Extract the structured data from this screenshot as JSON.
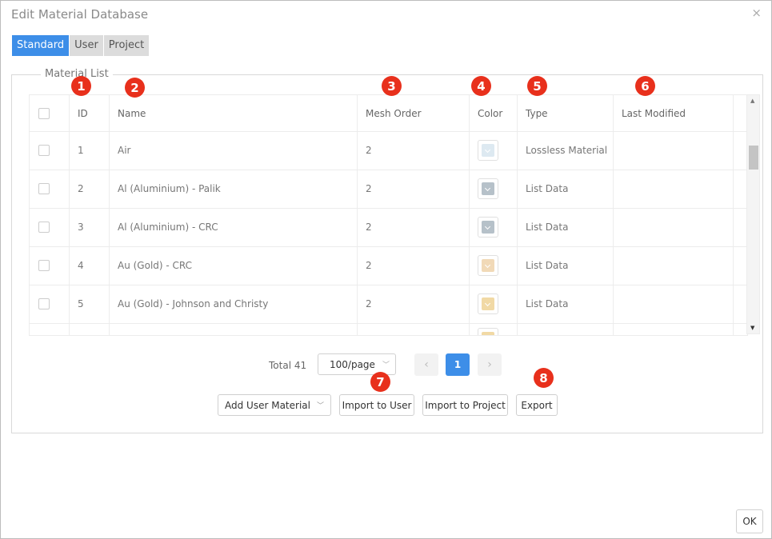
{
  "dialog": {
    "title": "Edit Material Database",
    "close_glyph": "×"
  },
  "tabs": [
    {
      "label": "Standard",
      "active": true
    },
    {
      "label": "User",
      "active": false
    },
    {
      "label": "Project",
      "active": false
    }
  ],
  "material_list": {
    "legend": "Material List",
    "columns": [
      "ID",
      "Name",
      "Mesh Order",
      "Color",
      "Type",
      "Last Modified"
    ],
    "rows": [
      {
        "id": "1",
        "name": "Air",
        "mesh_order": "2",
        "color": "#dde9f1",
        "type": "Lossless Material",
        "last_modified": ""
      },
      {
        "id": "2",
        "name": "Al (Aluminium) - Palik",
        "mesh_order": "2",
        "color": "#b6c1c9",
        "type": "List Data",
        "last_modified": ""
      },
      {
        "id": "3",
        "name": "Al (Aluminium) - CRC",
        "mesh_order": "2",
        "color": "#b6c1c9",
        "type": "List Data",
        "last_modified": ""
      },
      {
        "id": "4",
        "name": "Au (Gold) - CRC",
        "mesh_order": "2",
        "color": "#f1d9b7",
        "type": "List Data",
        "last_modified": ""
      },
      {
        "id": "5",
        "name": "Au (Gold) - Johnson and Christy",
        "mesh_order": "2",
        "color": "#f1d9a5",
        "type": "List Data",
        "last_modified": ""
      },
      {
        "id": "",
        "name": "",
        "mesh_order": "",
        "color": "#f1d9a5",
        "type": "",
        "last_modified": ""
      }
    ]
  },
  "pagination": {
    "total_label": "Total 41",
    "page_size": "100/page",
    "current_page": "1",
    "prev_glyph": "‹",
    "next_glyph": "›"
  },
  "actions": {
    "add_user_material": "Add User Material",
    "import_to_user": "Import to User",
    "import_to_project": "Import to Project",
    "export": "Export"
  },
  "footer": {
    "ok": "OK"
  },
  "annotations": [
    "1",
    "2",
    "3",
    "4",
    "5",
    "6",
    "7",
    "8"
  ],
  "colors": {
    "accent": "#3d8ee8",
    "annotation": "#e8301c"
  }
}
